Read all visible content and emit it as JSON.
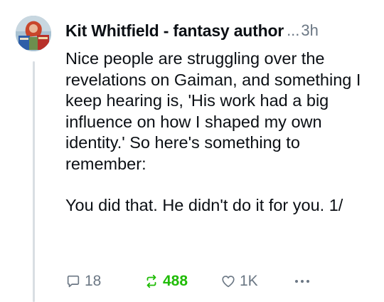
{
  "post": {
    "author": "Kit Whitfield - fantasy author",
    "ellipsis": "...",
    "time": "3h",
    "paragraphs": [
      "Nice people are struggling over the revelations on Gaiman, and something I keep hearing is, 'His work had a big influence on how I shaped my own identity.' So here's something to remember:",
      "You did that. He didn't do it for you. 1/"
    ]
  },
  "actions": {
    "reply_count": "18",
    "repost_count": "488",
    "like_count": "1K"
  },
  "colors": {
    "text": "#0b0f14",
    "muted": "#6b7784",
    "repost_active": "#20bc07",
    "thread_line": "#d9dee3"
  },
  "icons": [
    "avatar-image",
    "reply-icon",
    "repost-icon",
    "like-icon",
    "more-icon"
  ]
}
